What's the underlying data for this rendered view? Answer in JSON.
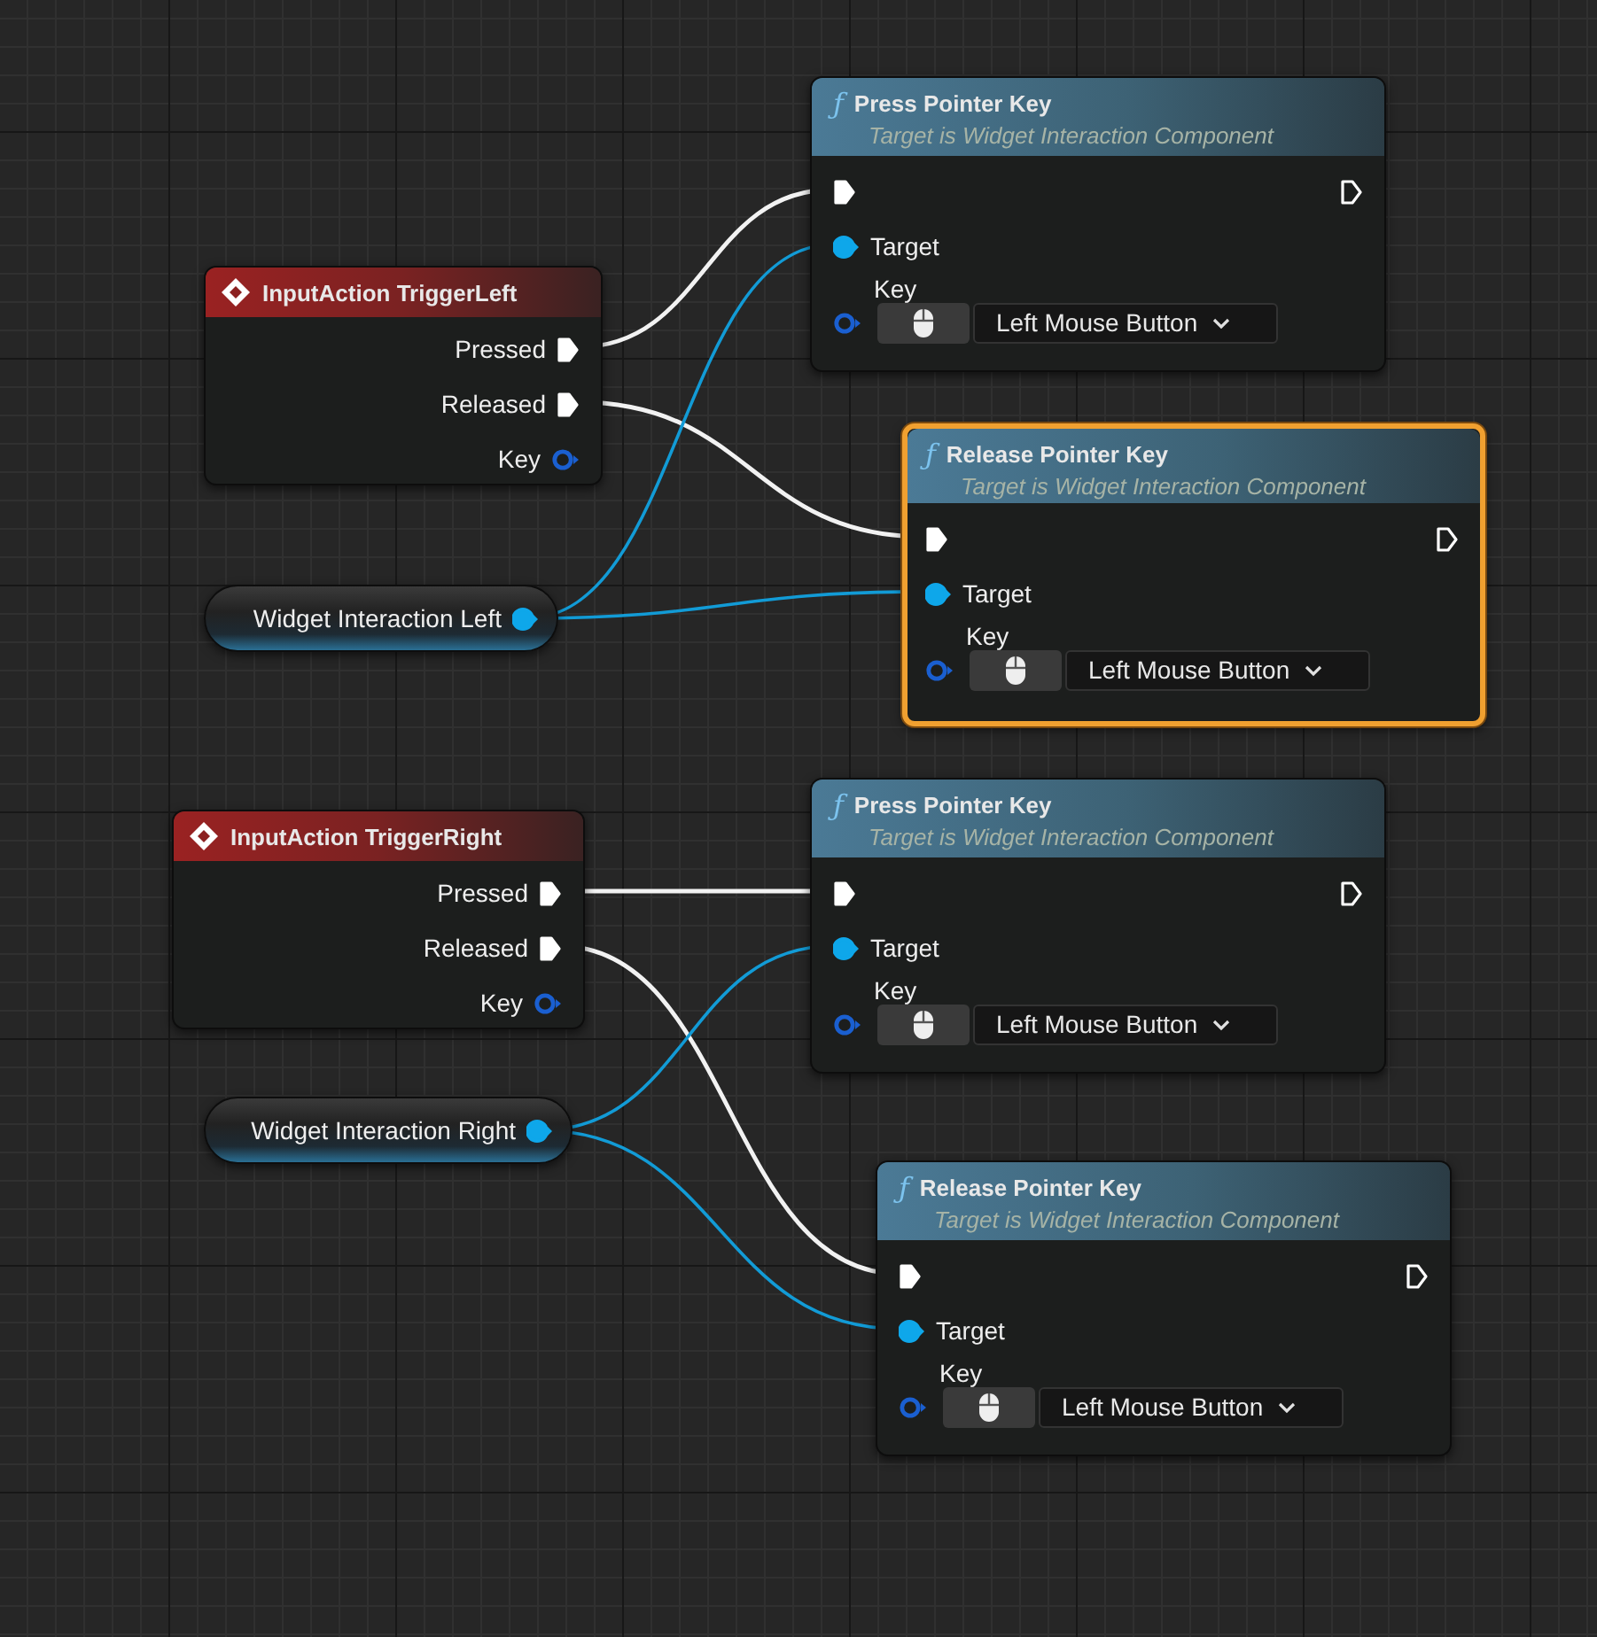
{
  "graph": {
    "nodes": [
      {
        "kind": "event",
        "title": "InputAction TriggerLeft",
        "selected": false,
        "pins": [
          {
            "kind": "exec",
            "label": "Pressed",
            "connected": true
          },
          {
            "kind": "exec",
            "label": "Released",
            "connected": true
          },
          {
            "kind": "struct",
            "label": "Key",
            "connected": false
          }
        ]
      },
      {
        "kind": "variable",
        "title": "Widget Interaction Left",
        "selected": false,
        "connected": true
      },
      {
        "kind": "event",
        "title": "InputAction TriggerRight",
        "selected": false,
        "pins": [
          {
            "kind": "exec",
            "label": "Pressed",
            "connected": true
          },
          {
            "kind": "exec",
            "label": "Released",
            "connected": true
          },
          {
            "kind": "struct",
            "label": "Key",
            "connected": false
          }
        ]
      },
      {
        "kind": "variable",
        "title": "Widget Interaction Right",
        "selected": false,
        "connected": true
      },
      {
        "kind": "function",
        "glyph": "ƒ",
        "title": "Press Pointer Key",
        "subtitle": "Target is Widget Interaction Component",
        "selected": false,
        "exec_in": {
          "connected": true
        },
        "exec_out": {
          "connected": false
        },
        "target": {
          "label": "Target",
          "connected": true
        },
        "key": {
          "label": "Key",
          "connected": false,
          "value": "Left Mouse Button"
        }
      },
      {
        "kind": "function",
        "glyph": "ƒ",
        "title": "Release Pointer Key",
        "subtitle": "Target is Widget Interaction Component",
        "selected": true,
        "exec_in": {
          "connected": true
        },
        "exec_out": {
          "connected": false
        },
        "target": {
          "label": "Target",
          "connected": true
        },
        "key": {
          "label": "Key",
          "connected": false,
          "value": "Left Mouse Button"
        }
      },
      {
        "kind": "function",
        "glyph": "ƒ",
        "title": "Press Pointer Key",
        "subtitle": "Target is Widget Interaction Component",
        "selected": false,
        "exec_in": {
          "connected": true
        },
        "exec_out": {
          "connected": false
        },
        "target": {
          "label": "Target",
          "connected": true
        },
        "key": {
          "label": "Key",
          "connected": false,
          "value": "Left Mouse Button"
        }
      },
      {
        "kind": "function",
        "glyph": "ƒ",
        "title": "Release Pointer Key",
        "subtitle": "Target is Widget Interaction Component",
        "selected": false,
        "exec_in": {
          "connected": true
        },
        "exec_out": {
          "connected": false
        },
        "target": {
          "label": "Target",
          "connected": true
        },
        "key": {
          "label": "Key",
          "connected": false,
          "value": "Left Mouse Button"
        }
      }
    ]
  }
}
